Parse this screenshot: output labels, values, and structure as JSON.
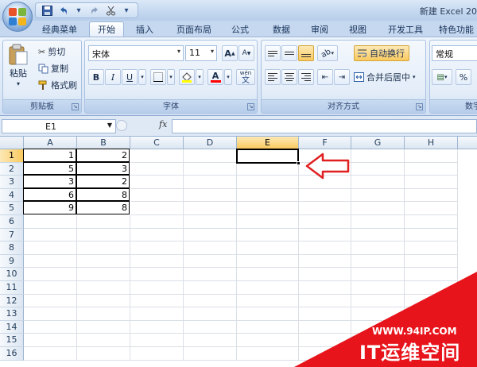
{
  "window": {
    "title": "新建 Excel 20"
  },
  "quick_access": {
    "icons": [
      "save-icon",
      "undo-icon",
      "redo-icon",
      "cut-icon",
      "customize-icon"
    ]
  },
  "tabs": [
    {
      "label": "经典菜单",
      "active": false
    },
    {
      "label": "开始",
      "active": true
    },
    {
      "label": "插入",
      "active": false
    },
    {
      "label": "页面布局",
      "active": false
    },
    {
      "label": "公式",
      "active": false
    },
    {
      "label": "数据",
      "active": false
    },
    {
      "label": "审阅",
      "active": false
    },
    {
      "label": "视图",
      "active": false
    },
    {
      "label": "开发工具",
      "active": false
    },
    {
      "label": "特色功能",
      "active": false
    }
  ],
  "ribbon": {
    "clipboard": {
      "group_label": "剪贴板",
      "paste": "粘贴",
      "cut": "剪切",
      "copy": "复制",
      "format_painter": "格式刷"
    },
    "font": {
      "group_label": "字体",
      "font_name": "宋体",
      "font_size": "11",
      "bold": "B",
      "italic": "I",
      "underline": "U",
      "font_color": "A",
      "grow": "A",
      "shrink": "A",
      "phonetic": "wén",
      "highlight_color": "#ffff00",
      "font_color_hex": "#ff0000"
    },
    "alignment": {
      "group_label": "对齐方式",
      "wrap_text": "自动换行",
      "merge_center": "合并后居中"
    },
    "number": {
      "group_label": "数字",
      "format": "常规",
      "percent": "%"
    }
  },
  "formula_bar": {
    "name_box": "E1",
    "fx": "fx",
    "formula": ""
  },
  "sheet": {
    "columns": [
      "A",
      "B",
      "C",
      "D",
      "E",
      "F",
      "G",
      "H"
    ],
    "rows": [
      "1",
      "2",
      "3",
      "4",
      "5",
      "6",
      "7",
      "8",
      "9",
      "10",
      "11",
      "12",
      "13",
      "14",
      "15",
      "16"
    ],
    "active_cell": "E1",
    "data": [
      [
        "1",
        "2"
      ],
      [
        "5",
        "3"
      ],
      [
        "3",
        "2"
      ],
      [
        "6",
        "8"
      ],
      [
        "9",
        "8"
      ]
    ]
  },
  "annotation": {
    "arrow_color": "#e02020"
  },
  "watermark": {
    "url": "WWW.94IP.COM",
    "brand": "IT运维空间",
    "color": "#e8141b"
  }
}
